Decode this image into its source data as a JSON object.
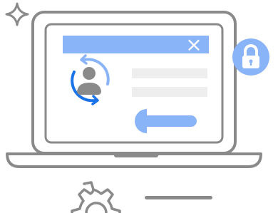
{
  "illustration": {
    "close_symbol": "×"
  },
  "icons": {
    "sparkle": "sparkle-icon",
    "laptop": "laptop-icon",
    "close": "close-icon",
    "user_sync": "user-sync-icon",
    "wrench": "wrench-icon",
    "lock": "lock-icon",
    "gear": "gear-icon"
  },
  "colors": {
    "outline_gray": "#8a8a8a",
    "light_gray": "#d9d9d9",
    "pale_gray": "#eeeeee",
    "accent_blue": "#8ab4f8",
    "dark_blue": "#1a73e8",
    "white": "#ffffff"
  }
}
